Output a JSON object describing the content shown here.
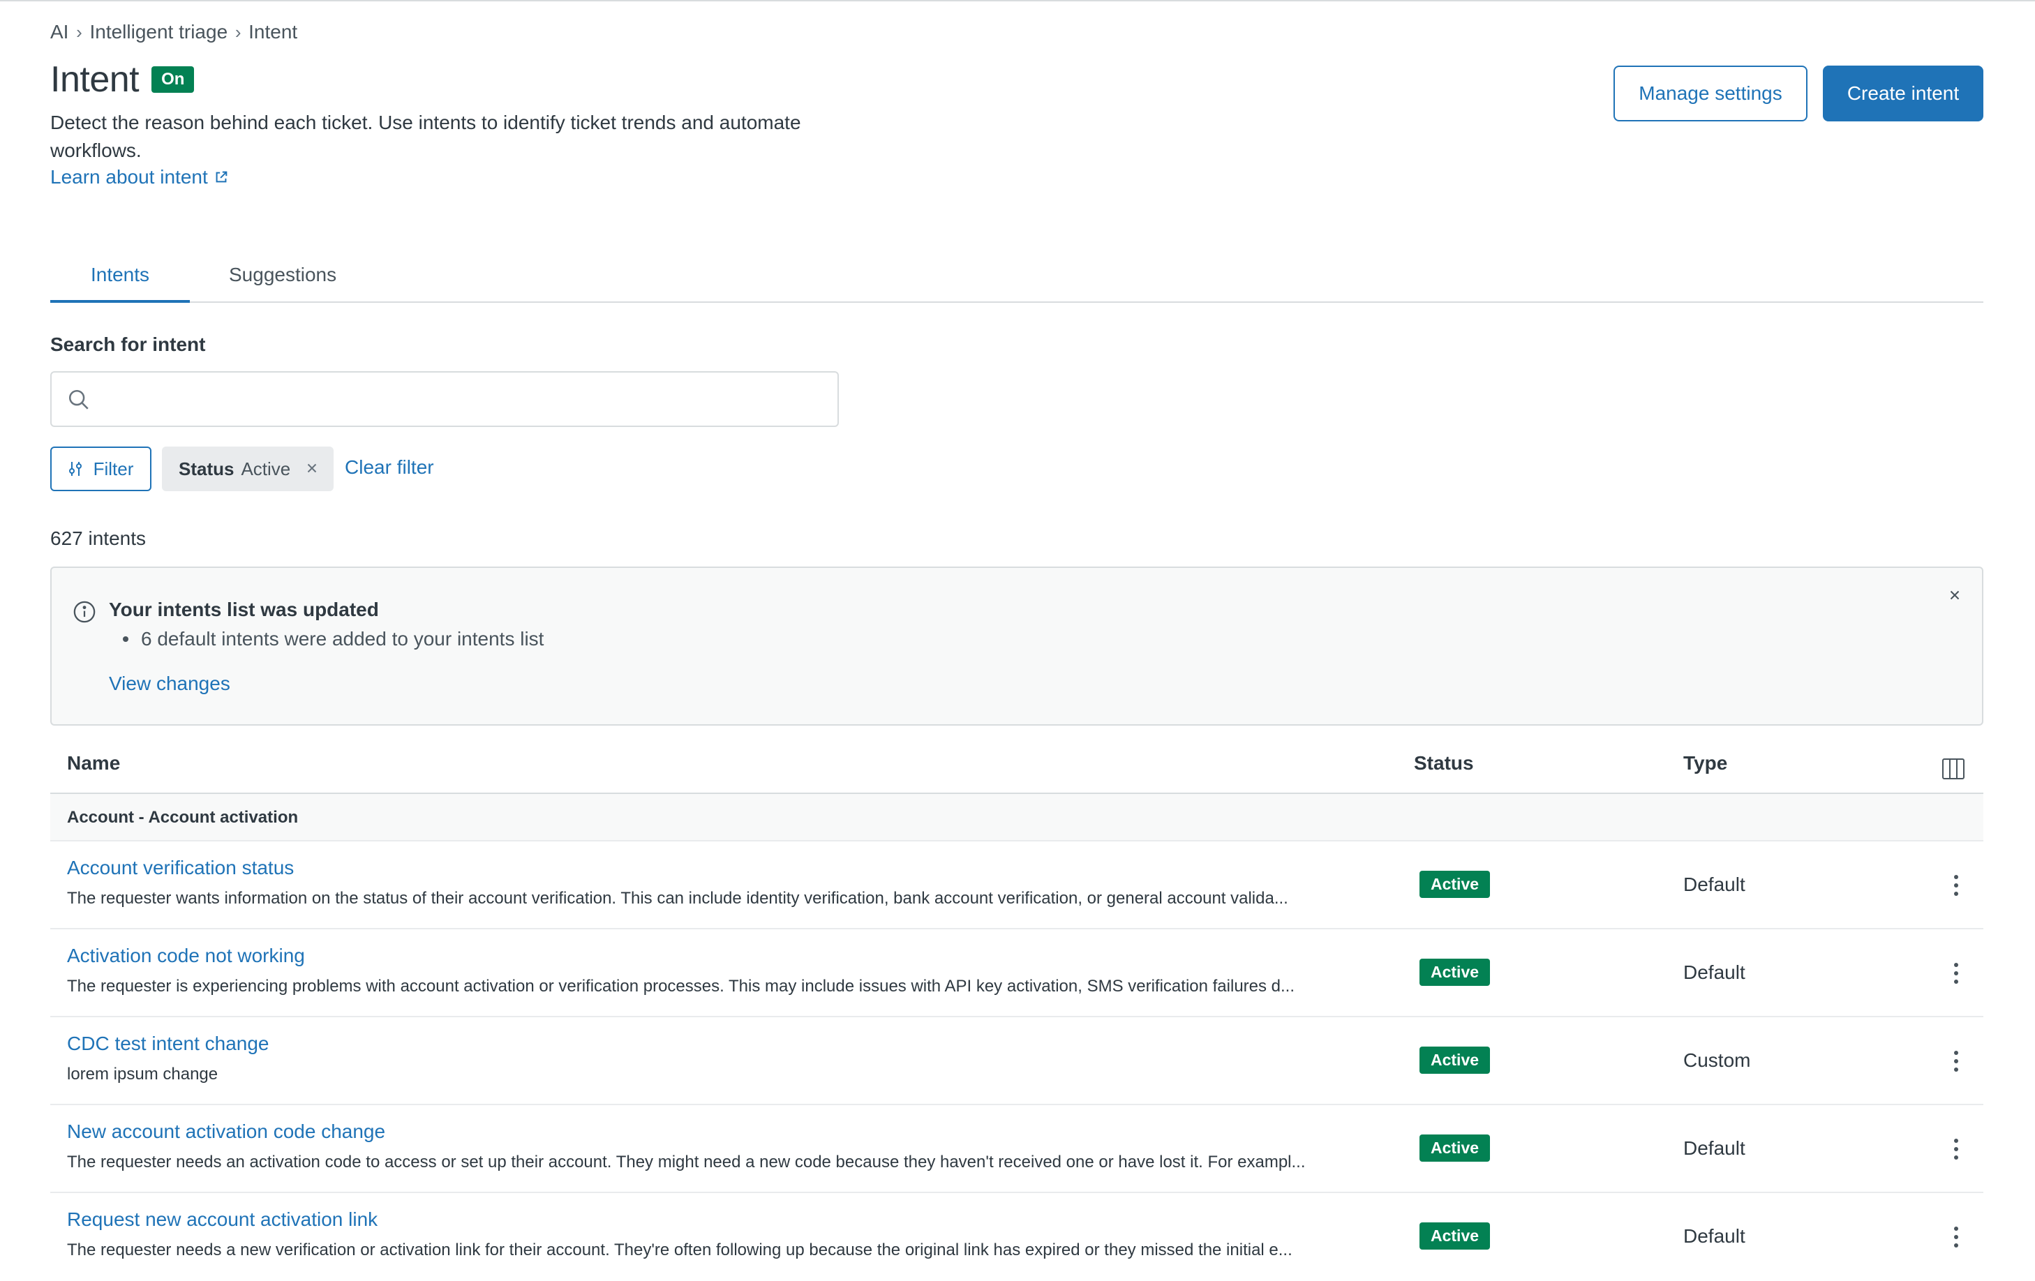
{
  "breadcrumb": [
    "AI",
    "Intelligent triage",
    "Intent"
  ],
  "header": {
    "title": "Intent",
    "status_badge": "On",
    "description": "Detect the reason behind each ticket. Use intents to identify ticket trends and automate workflows.",
    "learn_link": "Learn about intent",
    "manage_settings": "Manage settings",
    "create_intent": "Create intent"
  },
  "tabs": [
    {
      "label": "Intents",
      "active": true
    },
    {
      "label": "Suggestions",
      "active": false
    }
  ],
  "search": {
    "label": "Search for intent",
    "value": "",
    "placeholder": ""
  },
  "filters": {
    "filter_button": "Filter",
    "chip_key": "Status",
    "chip_value": "Active",
    "clear": "Clear filter"
  },
  "count_text": "627 intents",
  "notice": {
    "title": "Your intents list was updated",
    "bullet": "6 default intents were added to your intents list",
    "link": "View changes"
  },
  "table": {
    "headers": {
      "name": "Name",
      "status": "Status",
      "type": "Type"
    },
    "group": "Account - Account activation",
    "rows": [
      {
        "name": "Account verification status",
        "description": "The requester wants information on the status of their account verification. This can include identity verification, bank account verification, or general account valida...",
        "status": "Active",
        "type": "Default"
      },
      {
        "name": "Activation code not working",
        "description": "The requester is experiencing problems with account activation or verification processes. This may include issues with API key activation, SMS verification failures d...",
        "status": "Active",
        "type": "Default"
      },
      {
        "name": "CDC test intent change",
        "description": "lorem ipsum change",
        "status": "Active",
        "type": "Custom"
      },
      {
        "name": "New account activation code change",
        "description": "The requester needs an activation code to access or set up their account. They might need a new code because they haven't received one or have lost it. For exampl...",
        "status": "Active",
        "type": "Default"
      },
      {
        "name": "Request new account activation link",
        "description": "The requester needs a new verification or activation link for their account. They're often following up because the original link has expired or they missed the initial e...",
        "status": "Active",
        "type": "Default"
      }
    ]
  },
  "colors": {
    "accent": "#1f73b7",
    "success": "#038153",
    "text": "#2f3941",
    "border": "#d8dcde"
  }
}
